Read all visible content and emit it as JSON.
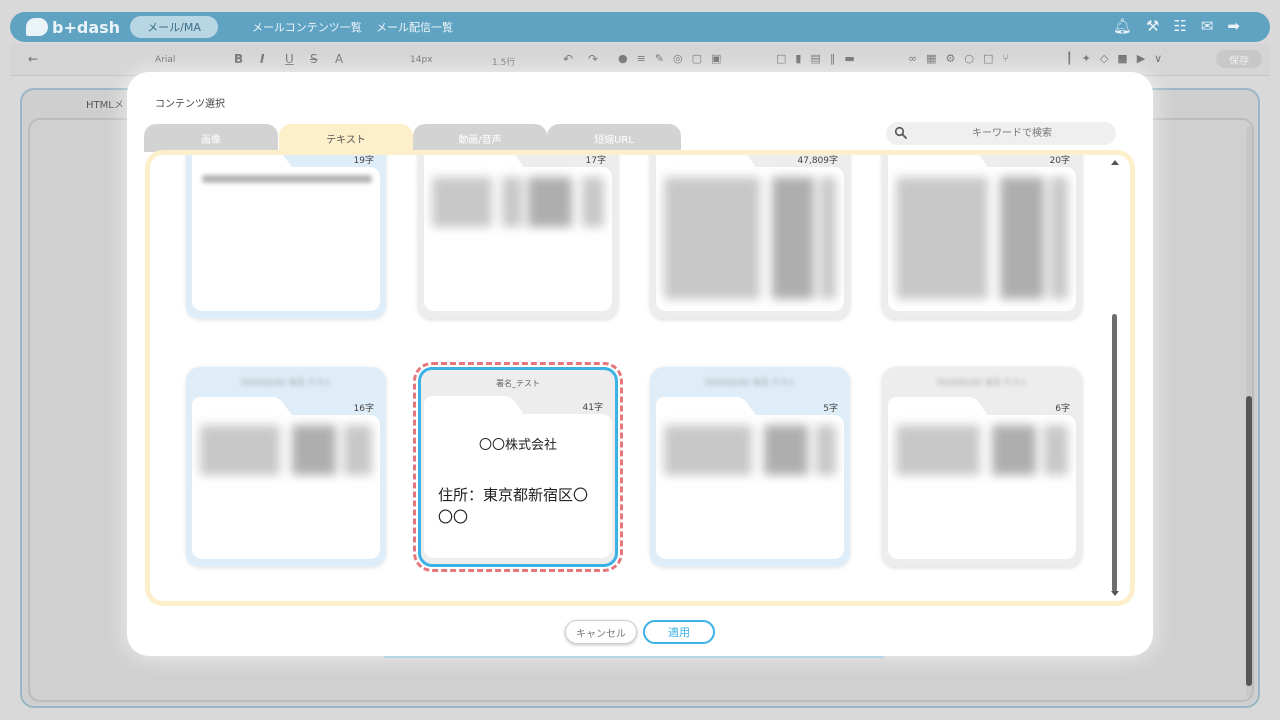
{
  "app": {
    "logo": "b+dash",
    "active_tab": "メール/MA",
    "nav": [
      "メールコンテンツ一覧",
      "メール配信一覧"
    ],
    "toolbar": {
      "font": "Arial",
      "font_size": "14px",
      "line_height": "1.5行",
      "save": "保存"
    },
    "bg_label": "HTMLメ"
  },
  "modal": {
    "title": "コンテンツ選択",
    "tabs": [
      "画像",
      "テキスト",
      "動画/音声",
      "短縮URL"
    ],
    "active_tab": "テキスト",
    "search_placeholder": "キーワードで検索",
    "cards": [
      {
        "count": "19字",
        "selected": false,
        "style": "blue"
      },
      {
        "count": "17字",
        "selected": false,
        "style": "gray"
      },
      {
        "count": "47,809字",
        "selected": false,
        "style": "gray"
      },
      {
        "count": "20字",
        "selected": false,
        "style": "gray"
      },
      {
        "count": "16字",
        "selected": false,
        "style": "blue"
      },
      {
        "title": "署名_テスト",
        "count": "41字",
        "selected": true,
        "style": "gray",
        "company": "〇〇株式会社",
        "address": "住所：東京都新宿区〇〇〇"
      },
      {
        "count": "5字",
        "selected": false,
        "style": "blue"
      },
      {
        "count": "6字",
        "selected": false,
        "style": "gray"
      }
    ],
    "cancel": "キャンセル",
    "apply": "適用"
  },
  "colors": {
    "brand": "#5fa2c2",
    "active_tab": "#fcefc9",
    "selection_border": "#3bb1e6",
    "selection_dash": "#e5767c"
  }
}
